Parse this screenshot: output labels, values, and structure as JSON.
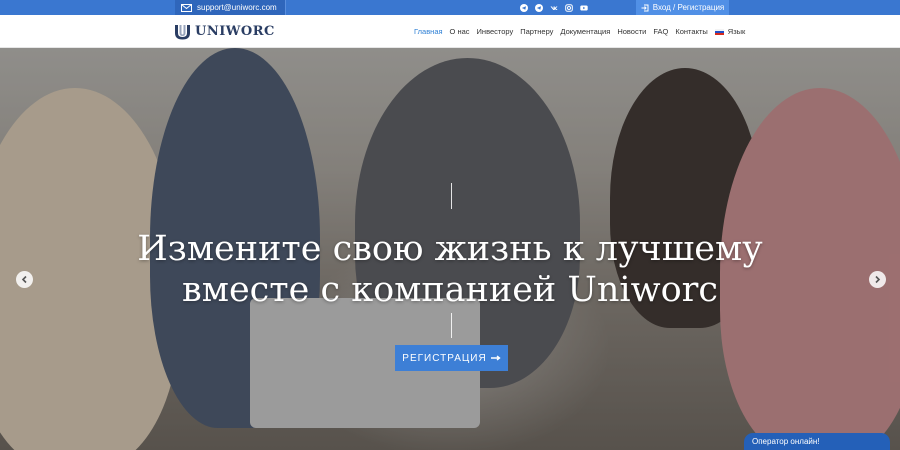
{
  "topbar": {
    "email": "support@uniworc.com",
    "socials": [
      "telegram-icon",
      "telegram-channel-icon",
      "vk-icon",
      "instagram-icon",
      "youtube-icon"
    ],
    "login_label": "Вход / Регистрация"
  },
  "header": {
    "logo_text": "UNIWORC",
    "nav": [
      {
        "label": "Главная",
        "active": true
      },
      {
        "label": "О нас"
      },
      {
        "label": "Инвестору"
      },
      {
        "label": "Партнеру"
      },
      {
        "label": "Документация"
      },
      {
        "label": "Новости"
      },
      {
        "label": "FAQ"
      },
      {
        "label": "Контакты"
      }
    ],
    "language_label": "Язык"
  },
  "hero": {
    "headline_line1": "Измените свою жизнь к лучшему",
    "headline_line2": "вместе с компанией Uniworc",
    "cta_label": "РЕГИСТРАЦИЯ"
  },
  "chat": {
    "operator_label": "Оператор онлайн!"
  },
  "colors": {
    "topbar": "#3a77d0",
    "accent": "#3d7fd6",
    "active_nav": "#2d7fd4"
  }
}
